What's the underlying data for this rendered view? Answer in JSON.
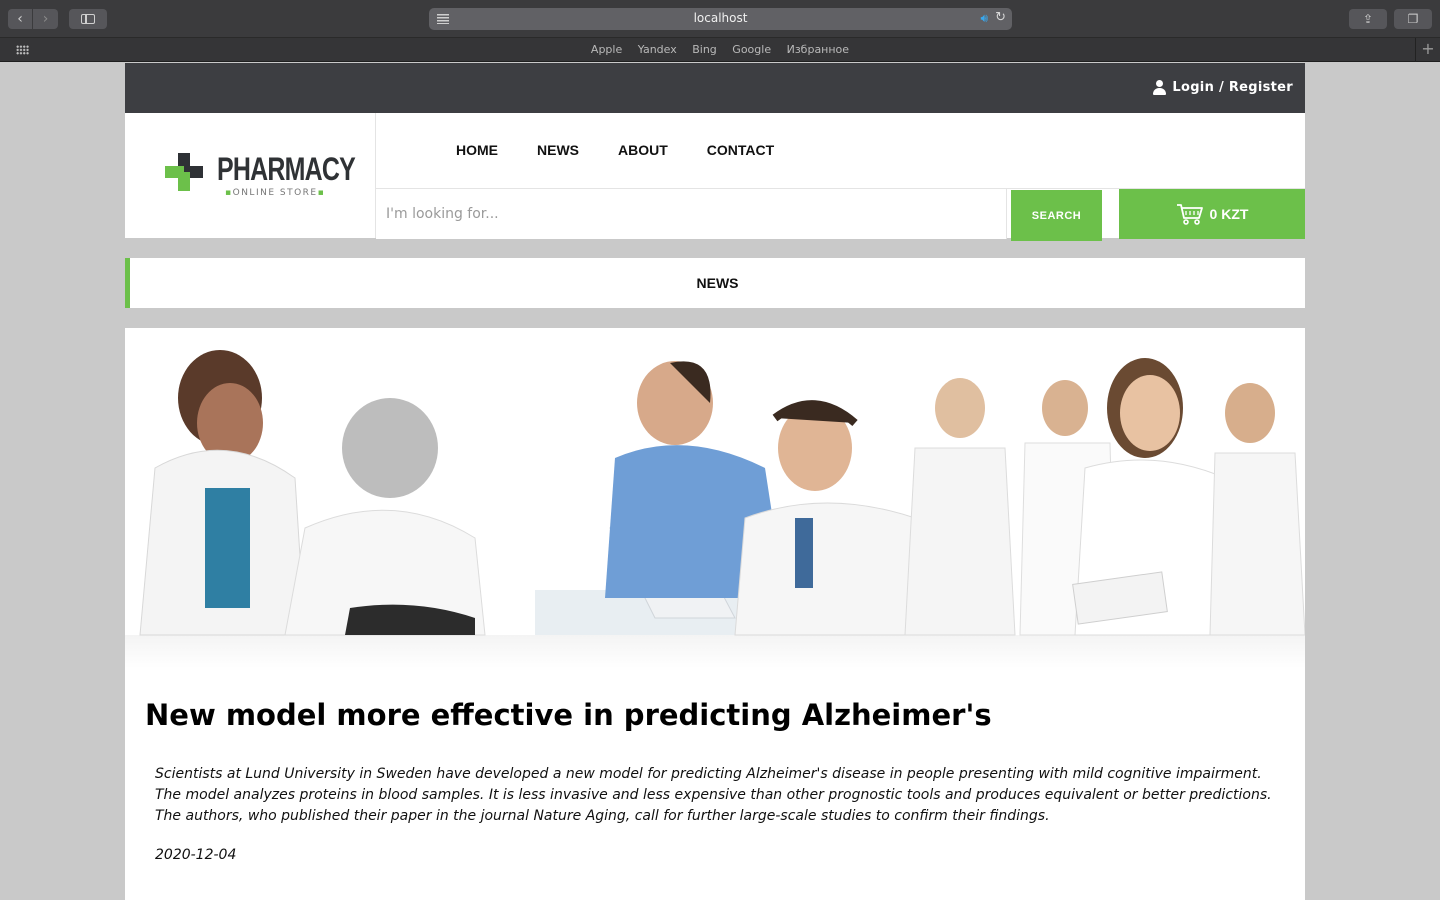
{
  "browser": {
    "url": "localhost",
    "bookmarks": [
      "Apple",
      "Yandex",
      "Bing",
      "Google",
      "Избранное"
    ]
  },
  "site": {
    "topbar": {
      "login_label": "Login / Register"
    },
    "logo": {
      "title": "PHARMACY",
      "subtitle": "ONLINE STORE"
    },
    "nav": [
      {
        "label": "HOME"
      },
      {
        "label": "NEWS"
      },
      {
        "label": "ABOUT"
      },
      {
        "label": "CONTACT"
      }
    ],
    "search": {
      "placeholder": "I'm looking for...",
      "button_label": "SEARCH"
    },
    "cart": {
      "total": "0 KZT"
    },
    "section_title": "NEWS",
    "article": {
      "title": "New model more effective in predicting Alzheimer's",
      "body": "Scientists at Lund University in Sweden have developed a new model for predicting Alzheimer's disease in people presenting with mild cognitive impairment. The model analyzes proteins in blood samples. It is less invasive and less expensive than other prognostic tools and produces equivalent or better predictions. The authors, who published their paper in the journal Nature Aging, call for further large-scale studies to confirm their findings.",
      "date": "2020-12-04"
    }
  },
  "colors": {
    "accent": "#6cc04a",
    "topbar": "#3d3e42",
    "page_bg": "#c9c9c9"
  }
}
